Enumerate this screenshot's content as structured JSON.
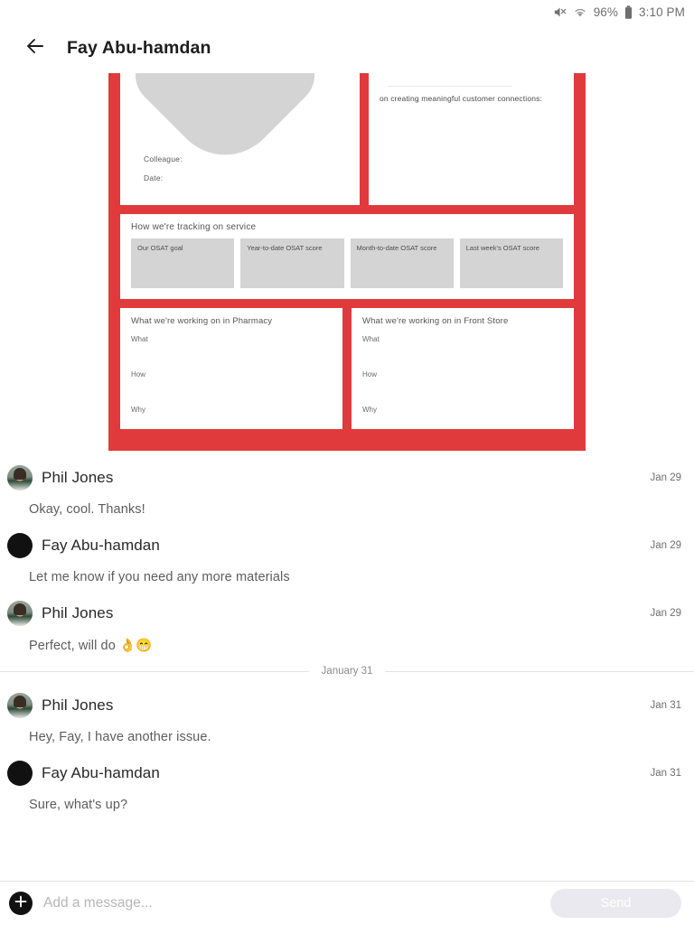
{
  "status_bar": {
    "mute_icon": "volume-off-icon",
    "wifi_icon": "wifi-icon",
    "battery_percent": "96%",
    "battery_icon": "battery-icon",
    "time": "3:10 PM"
  },
  "header": {
    "back_icon": "back-arrow-icon",
    "title": "Fay Abu-hamdan"
  },
  "attachment": {
    "name": "document-preview",
    "accent_color": "#e03a3c",
    "panel_color": "#ffffff",
    "box_color": "#d4d4d4",
    "top_left": {
      "colleague_label": "Colleague:",
      "date_label": "Date:"
    },
    "top_right": {
      "text": "on creating meaningful customer connections:"
    },
    "service_section": {
      "title": "How we're tracking on service",
      "boxes": [
        "Our OSAT goal",
        "Year-to-date\nOSAT score",
        "Month-to-date\nOSAT score",
        "Last week's\nOSAT score"
      ]
    },
    "working_on": [
      {
        "title": "What we're working on in Pharmacy",
        "fields": [
          "What",
          "How",
          "Why"
        ]
      },
      {
        "title": "What we're working on in Front Store",
        "fields": [
          "What",
          "How",
          "Why"
        ]
      }
    ]
  },
  "messages": [
    {
      "sender": "Phil Jones",
      "avatar": "photo",
      "timestamp": "Jan 29",
      "text": "Okay, cool. Thanks!"
    },
    {
      "sender": "Fay Abu-hamdan",
      "avatar": "solid",
      "timestamp": "Jan 29",
      "text": "Let me know if you need any more materials"
    },
    {
      "sender": "Phil Jones",
      "avatar": "photo",
      "timestamp": "Jan 29",
      "text": "Perfect, will do 👌😁"
    }
  ],
  "date_divider": {
    "label": "January 31"
  },
  "messages_after": [
    {
      "sender": "Phil Jones",
      "avatar": "photo",
      "timestamp": "Jan 31",
      "text": "Hey, Fay, I have another issue."
    },
    {
      "sender": "Fay Abu-hamdan",
      "avatar": "solid",
      "timestamp": "Jan 31",
      "text": "Sure, what's up?"
    }
  ],
  "composer": {
    "add_icon": "plus-icon",
    "input_value": "",
    "placeholder": "Add a message...",
    "send_label": "Send",
    "send_enabled": false
  }
}
